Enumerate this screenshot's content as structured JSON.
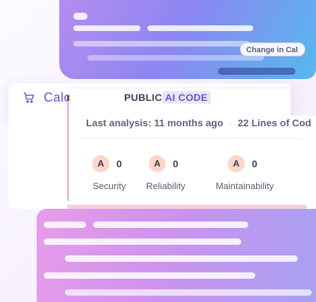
{
  "header": {
    "app_name": "Calc",
    "app_icon": "cart-icon",
    "visibility_badge": "PUBLIC",
    "tag_badge": "AI CODE"
  },
  "actions": {
    "change_label": "Change in Cal"
  },
  "analysis": {
    "label": "Last analysis:",
    "age": "11 months ago",
    "separator": "·",
    "lines": "22 Lines of Cod"
  },
  "metrics": [
    {
      "grade": "A",
      "count": "0",
      "label": "Security"
    },
    {
      "grade": "A",
      "count": "0",
      "label": "Reliability"
    },
    {
      "grade": "A",
      "count": "0",
      "label": "Maintainability"
    }
  ],
  "colors": {
    "accent": "#6b52c9",
    "grade_bg": "#fbd7c9",
    "tag_bg": "#ece6fb"
  }
}
